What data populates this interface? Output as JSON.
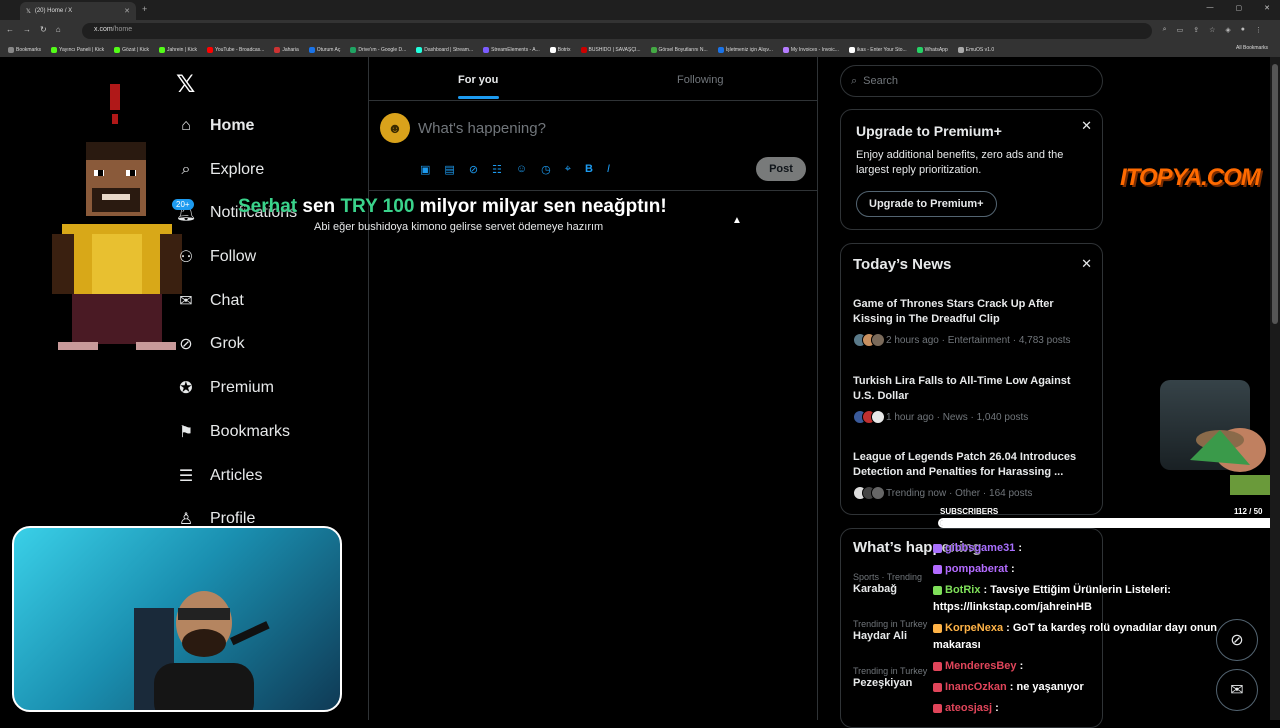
{
  "browser": {
    "tab_title": "(20) Home / X",
    "url_domain": "x.com",
    "url_path": "/home",
    "bookmarks": [
      "Bookmarks",
      "Yayıncı Paneli | Kick",
      "Gözat | Kick",
      "Jahrein | Kick",
      "YouTube - Broadcas...",
      "Jaharia",
      "Oturum Aç",
      "Drive'ım - Google D...",
      "Dashboard | Stream...",
      "StreamElements - A...",
      "Botrix",
      "BUSHIDO | SAVAŞÇI...",
      "Görsel Boyutlarını N...",
      "İşletmeniz için Alışv...",
      "My Invoices - Invoic...",
      "ikas - Enter Your Sto...",
      "WhatsApp",
      "EmuOS v1.0"
    ],
    "all_bookmarks": "All Bookmarks"
  },
  "nav": {
    "badge": "20+",
    "items": [
      "Home",
      "Explore",
      "Notifications",
      "Follow",
      "Chat",
      "Grok",
      "Premium",
      "Bookmarks",
      "Articles",
      "Profile"
    ]
  },
  "timeline": {
    "tab_for_you": "For you",
    "tab_following": "Following",
    "composer_placeholder": "What's happening?",
    "post_button": "Post"
  },
  "overlay": {
    "title_name": "Serhat",
    "title_mid": " sen ",
    "title_amount": "TRY 100",
    "title_rest": " milyor milyar sen neağptın!",
    "subtitle": "Abi eğer bushidoya kimono gelirse servet ödemeye hazırım"
  },
  "sidebar": {
    "search_placeholder": "Search",
    "premium": {
      "title": "Upgrade to Premium+",
      "body": "Enjoy additional benefits, zero ads and the largest reply prioritization.",
      "button": "Upgrade to Premium+"
    },
    "news": {
      "title": "Today’s News",
      "items": [
        {
          "headline": "Game of Thrones Stars Crack Up After Kissing in The Dreadful Clip",
          "meta": "2 hours ago · Entertainment · 4,783 posts"
        },
        {
          "headline": "Turkish Lira Falls to All-Time Low Against U.S. Dollar",
          "meta": "1 hour ago · News · 1,040 posts"
        },
        {
          "headline": "League of Legends Patch 26.04 Introduces Detection and Penalties for Harassing ...",
          "meta": "Trending now · Other · 164 posts"
        }
      ]
    },
    "happening": {
      "title": "What’s happening",
      "trends": [
        {
          "context": "Sports · Trending",
          "name": "Karabağ"
        },
        {
          "context": "Trending in Turkey",
          "name": "Haydar Ali"
        },
        {
          "context": "Trending in Turkey",
          "name": "Pezeşkiyan"
        }
      ]
    }
  },
  "stream": {
    "brand": "ITOPYA.COM",
    "subs_label": "SUBSCRIBERS",
    "subs_count": "112 / 50",
    "subs_fraction": 1.0,
    "chat": [
      {
        "user": "gibbsgame31",
        "text": " : ",
        "color": "#a970ff"
      },
      {
        "user": "pompaberat",
        "text": " : ",
        "color": "#b36bff"
      },
      {
        "user": "BotRix",
        "text": " : Tavsiye Ettiğim Ürünlerin Listeleri: https://linkstap.com/jahreinHB",
        "color": "#7fe05a"
      },
      {
        "user": "KorpeNexa",
        "text": " : GoT ta kardeş rolü oynadılar dayı onun makarası",
        "color": "#ffb347"
      },
      {
        "user": "MenderesBey",
        "text": " : ",
        "color": "#e0455a"
      },
      {
        "user": "InancOzkan",
        "text": " : ne yaşanıyor",
        "color": "#e0455a"
      },
      {
        "user": "ateosjasj",
        "text": " : ",
        "color": "#e0455a"
      }
    ]
  },
  "colors": {
    "accent": "#1d9bf0",
    "overlay_green": "#3ad38b",
    "brand_orange": "#ff6a00"
  }
}
